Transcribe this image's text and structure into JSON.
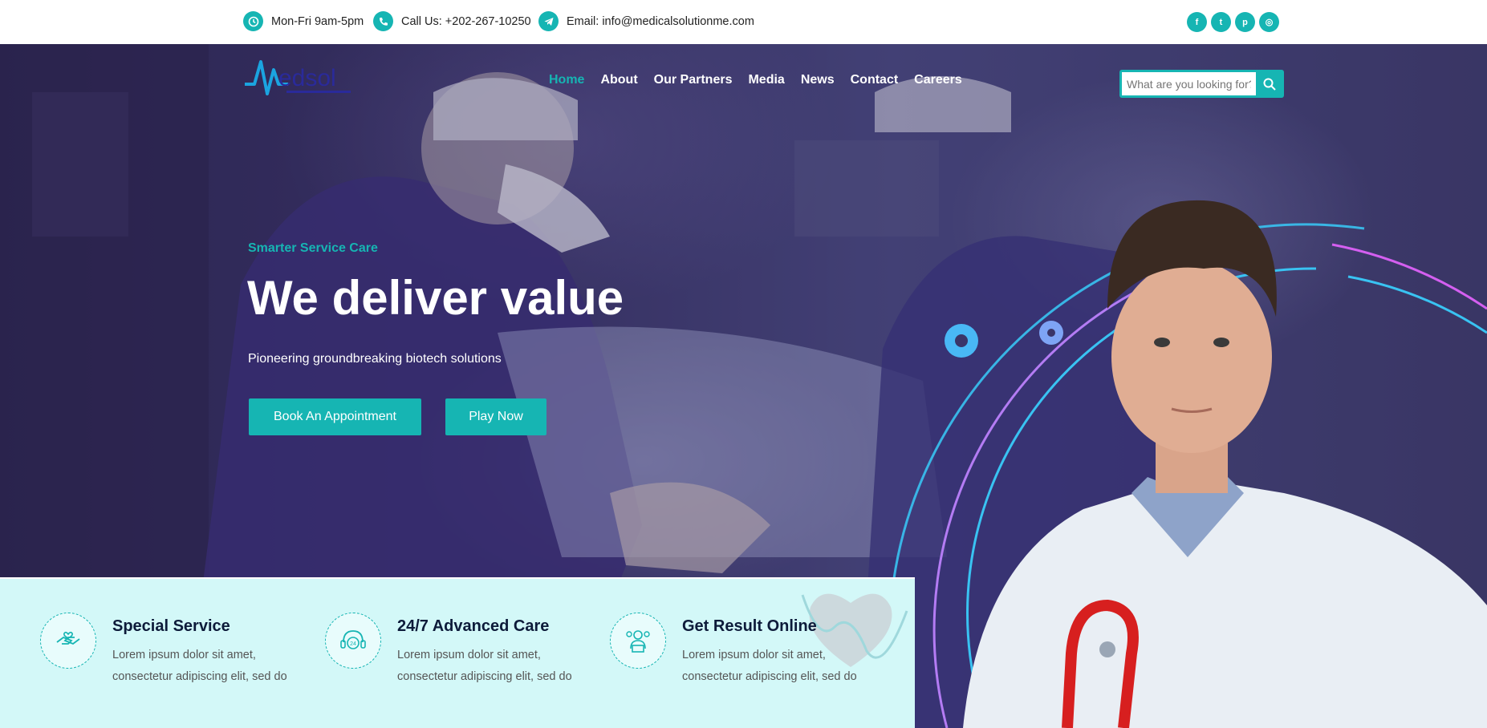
{
  "topbar": {
    "hours": "Mon-Fri 9am-5pm",
    "phone": "Call Us: +202-267-10250",
    "email": "Email: info@medicalsolutionme.com",
    "socials": [
      {
        "icon": "facebook-icon",
        "glyph": "f"
      },
      {
        "icon": "twitter-icon",
        "glyph": "t"
      },
      {
        "icon": "pinterest-icon",
        "glyph": "p"
      },
      {
        "icon": "instagram-icon",
        "glyph": "◎"
      }
    ]
  },
  "logo": {
    "text": "edsol"
  },
  "nav": {
    "items": [
      "Home",
      "About",
      "Our Partners",
      "Media",
      "News",
      "Contact",
      "Careers"
    ],
    "active": "Home"
  },
  "search": {
    "placeholder": "What are you looking for?"
  },
  "hero": {
    "eyebrow": "Smarter Service Care",
    "headline": "We deliver value",
    "subtitle": "Pioneering groundbreaking biotech solutions",
    "cta_primary": "Book An Appointment",
    "cta_secondary": "Play Now"
  },
  "features": [
    {
      "title": "Special Service",
      "line1": "Lorem ipsum dolor sit amet,",
      "line2": "consectetur adipiscing elit, sed do",
      "icon": "hands-heart-icon"
    },
    {
      "title": "24/7 Advanced Care",
      "line1": "Lorem ipsum dolor sit amet,",
      "line2": "consectetur adipiscing elit, sed do",
      "icon": "headset-24-icon"
    },
    {
      "title": "Get Result Online",
      "line1": "Lorem ipsum dolor sit amet,",
      "line2": "consectetur adipiscing elit, sed do",
      "icon": "doctor-laptop-icon"
    }
  ],
  "colors": {
    "accent": "#16b5b3",
    "panel": "#d3f8f8",
    "dark_text": "#0d1b3a",
    "hero_bg": "#3a3568"
  }
}
